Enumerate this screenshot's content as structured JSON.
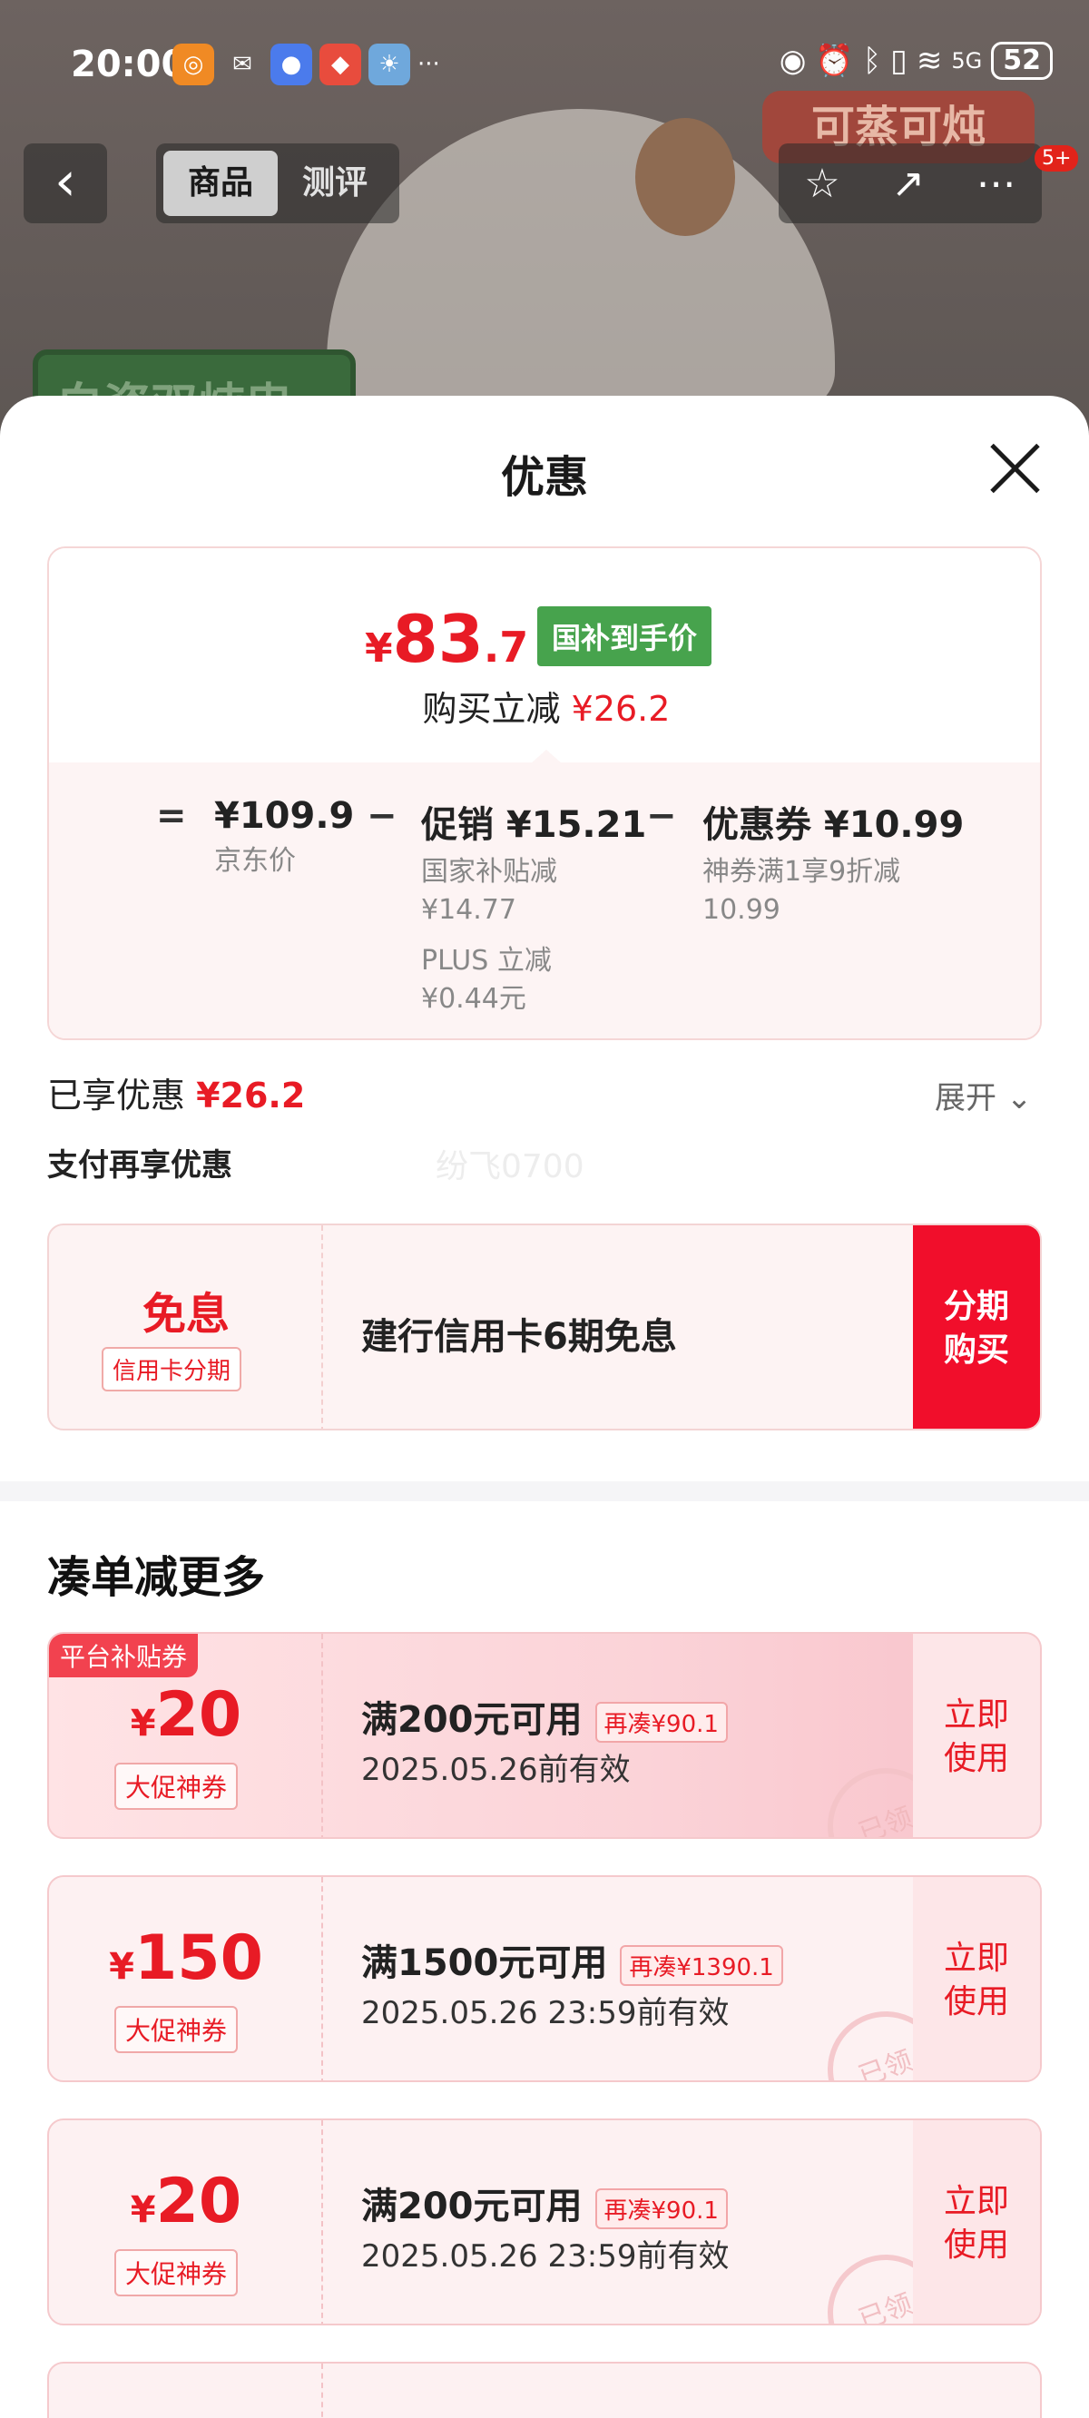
{
  "status": {
    "time": "20:00",
    "battery": "52",
    "network": "5G",
    "more": "···"
  },
  "background": {
    "tag_top": "可蒸可炖",
    "tag_left": "白瓷双炖盅"
  },
  "topnav": {
    "back": "‹",
    "tabs": [
      "商品",
      "测评"
    ],
    "badge": "5+"
  },
  "sheet": {
    "title": "优惠"
  },
  "price": {
    "currency": "¥",
    "integer": "83",
    "decimal": ".7",
    "tag": "国补到手价",
    "save_prefix": "购买立减",
    "save_amount": "¥26.2"
  },
  "breakdown": {
    "eq": "=",
    "minus": "−",
    "jd_price": "¥109.9",
    "jd_label": "京东价",
    "promo": "促销 ¥15.21",
    "promo_sub1": "国家补贴减",
    "promo_sub1_val": "¥14.77",
    "promo_sub2": "PLUS 立减",
    "promo_sub2_val": "¥0.44元",
    "coupon": "优惠券 ¥10.99",
    "coupon_sub": "神券满1享9折减",
    "coupon_sub_val": "10.99"
  },
  "enjoyed": {
    "label": "已享优惠",
    "amount": "¥26.2",
    "expand": "展开"
  },
  "pay_more": "支付再享优惠",
  "watermark": "纷飞0700",
  "installment": {
    "free": "免息",
    "tag": "信用卡分期",
    "text": "建行信用卡6期免息",
    "button_line1": "分期",
    "button_line2": "购买"
  },
  "section_title": "凑单减更多",
  "coupons": [
    {
      "platform": "平台补贴券",
      "currency": "¥",
      "amount": "20",
      "tag": "大促神券",
      "condition": "满200元可用",
      "need": "再凑¥90.1",
      "date": "2025.05.26前有效",
      "use1": "立即",
      "use2": "使用",
      "stamp": "已领"
    },
    {
      "platform": "",
      "currency": "¥",
      "amount": "150",
      "tag": "大促神券",
      "condition": "满1500元可用",
      "need": "再凑¥1390.1",
      "date": "2025.05.26 23:59前有效",
      "use1": "立即",
      "use2": "使用",
      "stamp": "已领"
    },
    {
      "platform": "",
      "currency": "¥",
      "amount": "20",
      "tag": "大促神券",
      "condition": "满200元可用",
      "need": "再凑¥90.1",
      "date": "2025.05.26 23:59前有效",
      "use1": "立即",
      "use2": "使用",
      "stamp": "已领"
    }
  ],
  "colors": {
    "accent_red": "#e81b25",
    "button_red": "#f10e2b",
    "gov_green": "#47a34d"
  }
}
